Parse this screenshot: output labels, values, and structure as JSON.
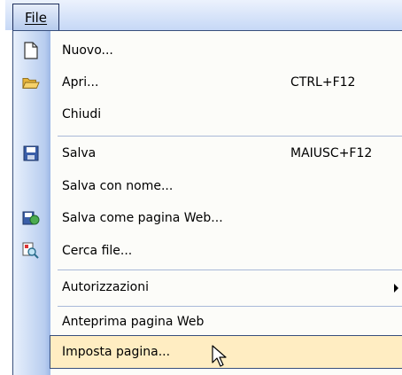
{
  "menubar": {
    "file_label": "File"
  },
  "menu": {
    "items": [
      {
        "label": "Nuovo...",
        "accel": "",
        "icon": "new-document-icon"
      },
      {
        "label": "Apri...",
        "accel": "CTRL+F12",
        "icon": "open-folder-icon"
      },
      {
        "label": "Chiudi",
        "accel": "",
        "icon": ""
      },
      {
        "label": "Salva",
        "accel": "MAIUSC+F12",
        "icon": "save-disk-icon"
      },
      {
        "label": "Salva con nome...",
        "accel": "",
        "icon": ""
      },
      {
        "label": "Salva come pagina Web...",
        "accel": "",
        "icon": "save-web-page-icon"
      },
      {
        "label": "Cerca file...",
        "accel": "",
        "icon": "search-file-icon"
      },
      {
        "label": "Autorizzazioni",
        "accel": "",
        "icon": "",
        "submenu": true
      },
      {
        "label": "Anteprima pagina Web",
        "accel": "",
        "icon": ""
      },
      {
        "label": "Imposta pagina...",
        "accel": "",
        "icon": "",
        "highlighted": true
      }
    ]
  },
  "colors": {
    "highlight": "#ffedc2",
    "border": "#384f7c",
    "gutter": "#b8cdef"
  }
}
